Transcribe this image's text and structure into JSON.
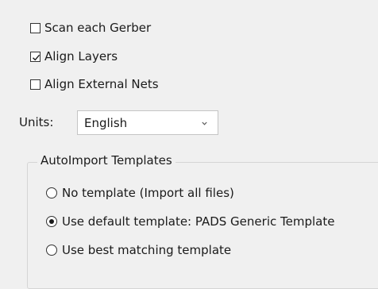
{
  "options": {
    "scan_each_gerber": {
      "label": "Scan each Gerber",
      "checked": false
    },
    "align_layers": {
      "label": "Align Layers",
      "checked": true
    },
    "align_external_nets": {
      "label": "Align External Nets",
      "checked": false
    }
  },
  "units": {
    "label": "Units:",
    "selected": "English",
    "chevron_icon": "chevron-down-icon"
  },
  "autoimport": {
    "title": "AutoImport Templates",
    "options": [
      {
        "label": "No template (Import all files)",
        "selected": false
      },
      {
        "label": "Use default template: PADS Generic Template",
        "selected": true
      },
      {
        "label": "Use best matching template",
        "selected": false
      }
    ]
  }
}
